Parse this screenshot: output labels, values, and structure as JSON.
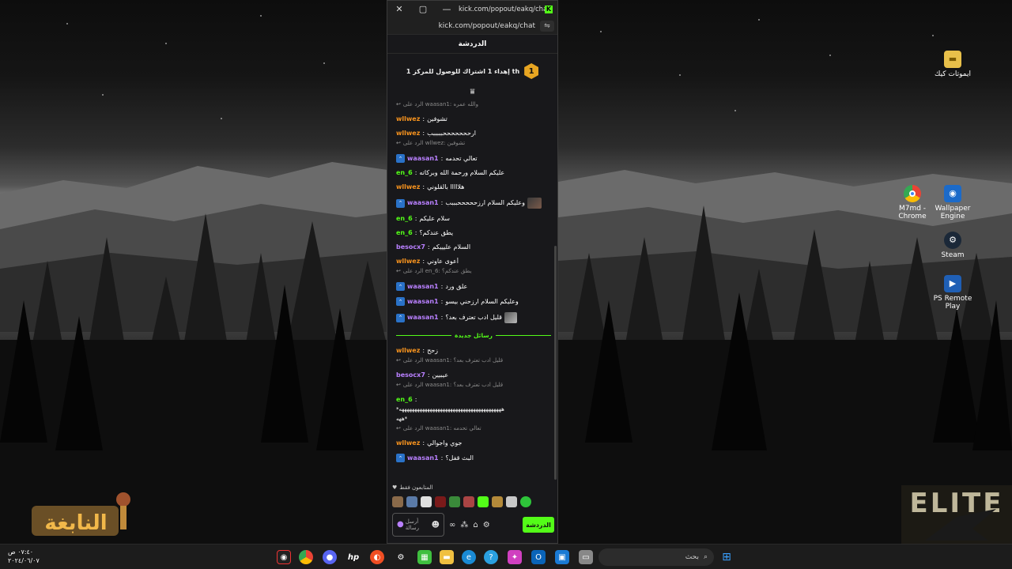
{
  "window": {
    "title": "kick.com/popout/eakq/chat...",
    "url": "kick.com/popout/eakq/chat",
    "close_glyph": "✕",
    "maximize_glyph": "▢",
    "minimize_glyph": "—",
    "kick_badge": "K"
  },
  "chat": {
    "header": "الدردشة",
    "goal_number": "1",
    "goal_text": "إهداء 1 اشتراك للوصول للمركز 1 th",
    "new_messages_label": "رسائل جديدة",
    "subs_only": "المتابعون فقط",
    "input_placeholder_1": "أرسل",
    "input_placeholder_2": "رسالة",
    "send_button": "الدردشة",
    "messages_before": [
      {
        "type": "reply",
        "text": "الرد على waasan1: والله عمره"
      },
      {
        "type": "msg",
        "user": "wllwez",
        "color": "or",
        "text": "تشوفين"
      },
      {
        "type": "msg",
        "user": "wllwez",
        "color": "or",
        "text": "ارحححححححبببببب"
      },
      {
        "type": "reply",
        "text": "الرد على wllwez: تشوفين"
      },
      {
        "type": "msg",
        "user": "waasan1",
        "color": "pu",
        "badge": true,
        "text": "تعالي تحدمه"
      },
      {
        "type": "msg",
        "user": "en_6",
        "color": "gr",
        "text": "عليكم السلام ورحمة الله وبركاته"
      },
      {
        "type": "msg",
        "user": "wllwez",
        "color": "or",
        "text": "هلااااا بالقلوني"
      },
      {
        "type": "msg",
        "user": "waasan1",
        "color": "pu",
        "badge": true,
        "text": "وعليكم السلام ارزحححححبببب",
        "emote": "dark"
      },
      {
        "type": "msg",
        "user": "en_6",
        "color": "gr",
        "text": "سلام عليكم"
      },
      {
        "type": "msg",
        "user": "en_6",
        "color": "gr",
        "text": "يطق عندكم؟"
      },
      {
        "type": "msg",
        "user": "besocx7",
        "color": "pu",
        "text": "السلام عليييكم"
      },
      {
        "type": "msg",
        "user": "wllwez",
        "color": "or",
        "text": "أعوى عاوني"
      },
      {
        "type": "reply",
        "text": "الرد على en_6: يطق عندكم؟"
      },
      {
        "type": "msg",
        "user": "waasan1",
        "color": "pu",
        "badge": true,
        "text": "علق ورد"
      },
      {
        "type": "msg",
        "user": "waasan1",
        "color": "pu",
        "badge": true,
        "text": "وعليكم السلام ارزحني بيسو"
      },
      {
        "type": "msg",
        "user": "waasan1",
        "color": "pu",
        "badge": true,
        "text": "قليل ادب تعترف بعد؟",
        "emote": "gray"
      }
    ],
    "messages_after": [
      {
        "type": "msg",
        "user": "wllwez",
        "color": "or",
        "text": "زحح"
      },
      {
        "type": "reply",
        "text": "الرد على waasan1: قليل ادب تعترف بعد؟"
      },
      {
        "type": "msg",
        "user": "besocx7",
        "color": "pu",
        "text": "عيبيين"
      },
      {
        "type": "reply",
        "text": "الرد على waasan1: قليل ادب تعترف بعد؟"
      },
      {
        "type": "msg",
        "user": "en_6",
        "color": "gr",
        "text": ""
      },
      {
        "type": "plain",
        "text": "*ههههههههههههههههههههههههههههههههههههههههه"
      },
      {
        "type": "plain",
        "text": "ههه*"
      },
      {
        "type": "reply",
        "text": "الرد على waasan1: تعالي تحدمه"
      },
      {
        "type": "msg",
        "user": "wllwez",
        "color": "or",
        "text": "جوي واجوالي"
      },
      {
        "type": "msg",
        "user": "waasan1",
        "color": "pu",
        "badge": true,
        "text": "البث قفل؟"
      }
    ]
  },
  "desktop_icons": [
    {
      "label": "ايموتات كيك",
      "icon": "folder-icon"
    },
    {
      "label": "M7md - Chrome",
      "icon": "chrome-icon"
    },
    {
      "label": "Wallpaper Engine",
      "icon": "wallpaper-engine-icon"
    },
    {
      "label": "Steam",
      "icon": "steam-icon"
    },
    {
      "label": "PS Remote Play",
      "icon": "ps-remote-play-icon"
    }
  ],
  "logos": {
    "left": "النابغة",
    "right": "ELITE"
  },
  "taskbar": {
    "search_placeholder": "بحث",
    "time": "٠٧:٤٠ ص",
    "date": "٢٠٢٤/٠٦/٠٧"
  }
}
